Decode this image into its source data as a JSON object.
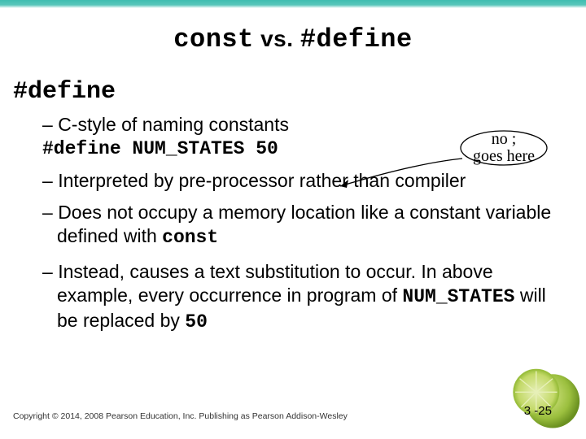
{
  "title": {
    "part1": "const",
    "vs": " vs. ",
    "part2": "#define"
  },
  "subhead": "#define",
  "callout": {
    "line1": "no ;",
    "line2": "goes here"
  },
  "bullets": {
    "b1_prefix": " C-style of naming constants",
    "code": "#define NUM_STATES 50",
    "b2": "Interpreted by pre-processor rather than compiler",
    "b3_a": "Does not occupy a memory location like a constant variable defined with ",
    "b3_b": "const",
    "b4_a": "Instead, causes a text substitution to occur. In above example, every occurrence in program of ",
    "b4_b": "NUM_STATES",
    "b4_c": " will be replaced by ",
    "b4_d": "50"
  },
  "footer": "Copyright © 2014, 2008 Pearson Education, Inc. Publishing as Pearson Addison-Wesley",
  "pagenum": "3 -25"
}
